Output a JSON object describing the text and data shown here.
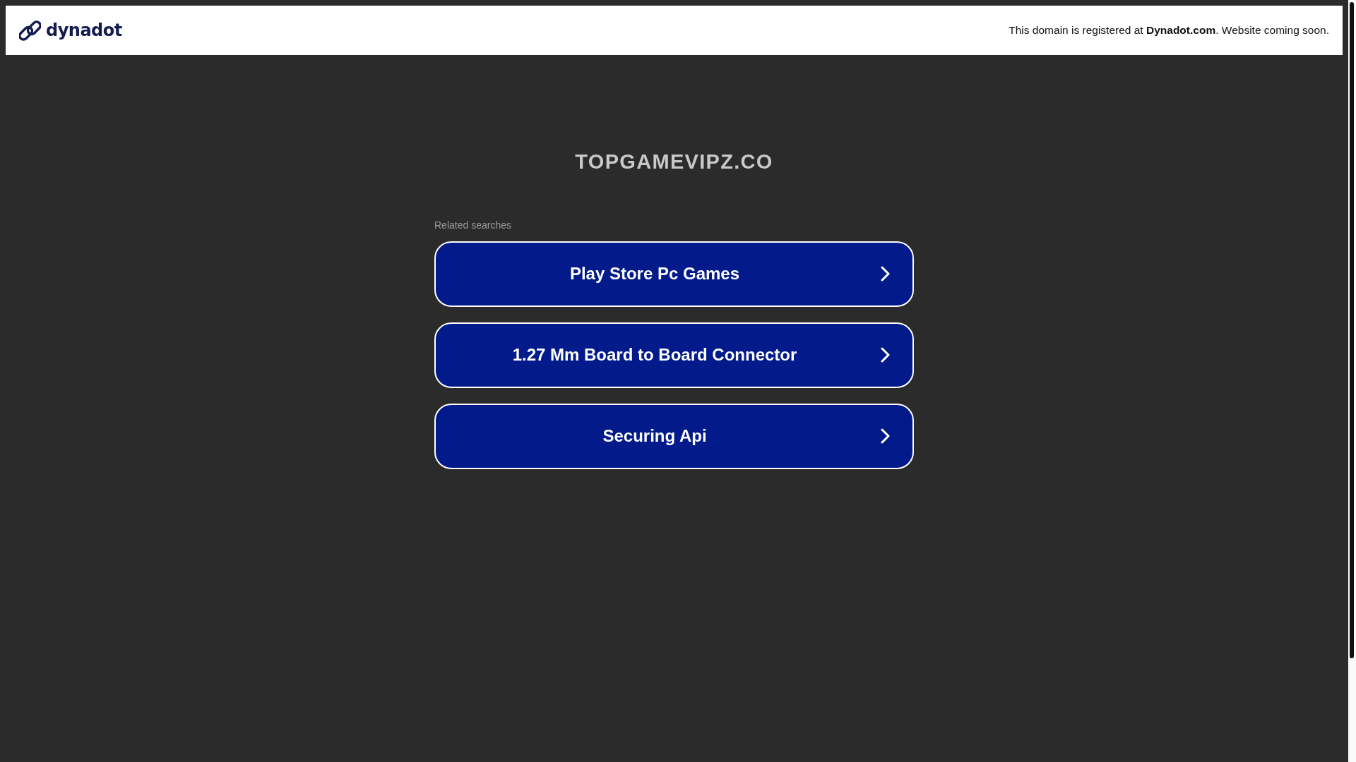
{
  "header": {
    "logo": {
      "text": "dynadot"
    },
    "notice": "This domain is registered at **Dynadot.com**. Website coming soon."
  },
  "domain": "TOPGAMEVIPZ.CO",
  "related": {
    "heading": "Related searches",
    "links": [
      {
        "label": "Play Store Pc Games"
      },
      {
        "label": "1.27 Mm Board to Board Connector"
      },
      {
        "label": "Securing Api"
      }
    ]
  }
}
